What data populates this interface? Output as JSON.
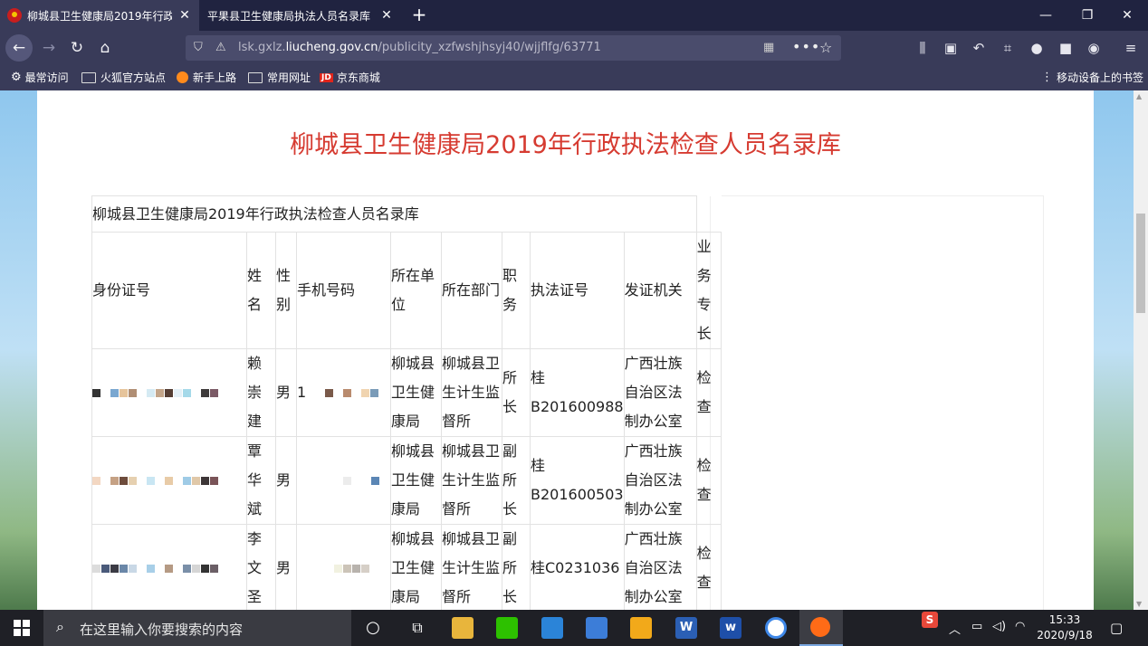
{
  "browser": {
    "tabs": [
      {
        "title": "柳城县卫生健康局2019年行政执",
        "active": true
      },
      {
        "title": "平果县卫生健康局执法人员名录库",
        "active": false
      }
    ],
    "url_prefix": "lsk.gxlz.",
    "url_domain": "liucheng.gov.cn",
    "url_path": "/publicity_xzfwshjhsyj40/wjjflfg/63771",
    "bookmarks": [
      {
        "label": "最常访问",
        "icon": "gear-icon"
      },
      {
        "label": "火狐官方站点",
        "icon": "folder-icon"
      },
      {
        "label": "新手上路",
        "icon": "firefox-icon"
      },
      {
        "label": "常用网址",
        "icon": "folder-icon"
      },
      {
        "label": "京东商城",
        "icon": "jd-icon"
      }
    ],
    "jd_badge": "JD",
    "mobile_bookmarks": "移动设备上的书签"
  },
  "page": {
    "heading": "柳城县卫生健康局2019年行政执法检查人员名录库",
    "table_caption": "柳城县卫生健康局2019年行政执法检查人员名录库",
    "headers": [
      "身份证号",
      "姓\n名",
      "性\n别",
      "手机号码",
      "所在单\n位",
      "所在部门",
      "职\n务",
      "执法证号",
      "发证机关",
      "业\n务\n专\n长"
    ],
    "rows": [
      {
        "name": "赖\n崇\n建",
        "gender": "男",
        "phone_prefix": "1",
        "unit": "柳城县\n卫生健\n康局",
        "dept": "柳城县卫\n生计生监\n督所",
        "title": "所\n长",
        "cert": "桂\nB201600988",
        "issuer": "广西壮族\n自治区法\n制办公室",
        "specialty": "检\n查"
      },
      {
        "name": "覃\n华\n斌",
        "gender": "男",
        "phone_prefix": "",
        "unit": "柳城县\n卫生健\n康局",
        "dept": "柳城县卫\n生计生监\n督所",
        "title": "副\n所\n长",
        "cert": "桂\nB201600503",
        "issuer": "广西壮族\n自治区法\n制办公室",
        "specialty": "检\n查"
      },
      {
        "name": "李\n文\n圣",
        "gender": "男",
        "phone_prefix": "",
        "unit": "柳城县\n卫生健\n康局",
        "dept": "柳城县卫\n生计生监\n督所",
        "title": "副\n所\n长",
        "cert": "桂C0231036",
        "issuer": "广西壮族\n自治区法\n制办公室",
        "specialty": "检\n查"
      }
    ]
  },
  "taskbar": {
    "search_placeholder": "在这里输入你要搜索的内容",
    "time": "15:33",
    "date": "2020/9/18"
  }
}
